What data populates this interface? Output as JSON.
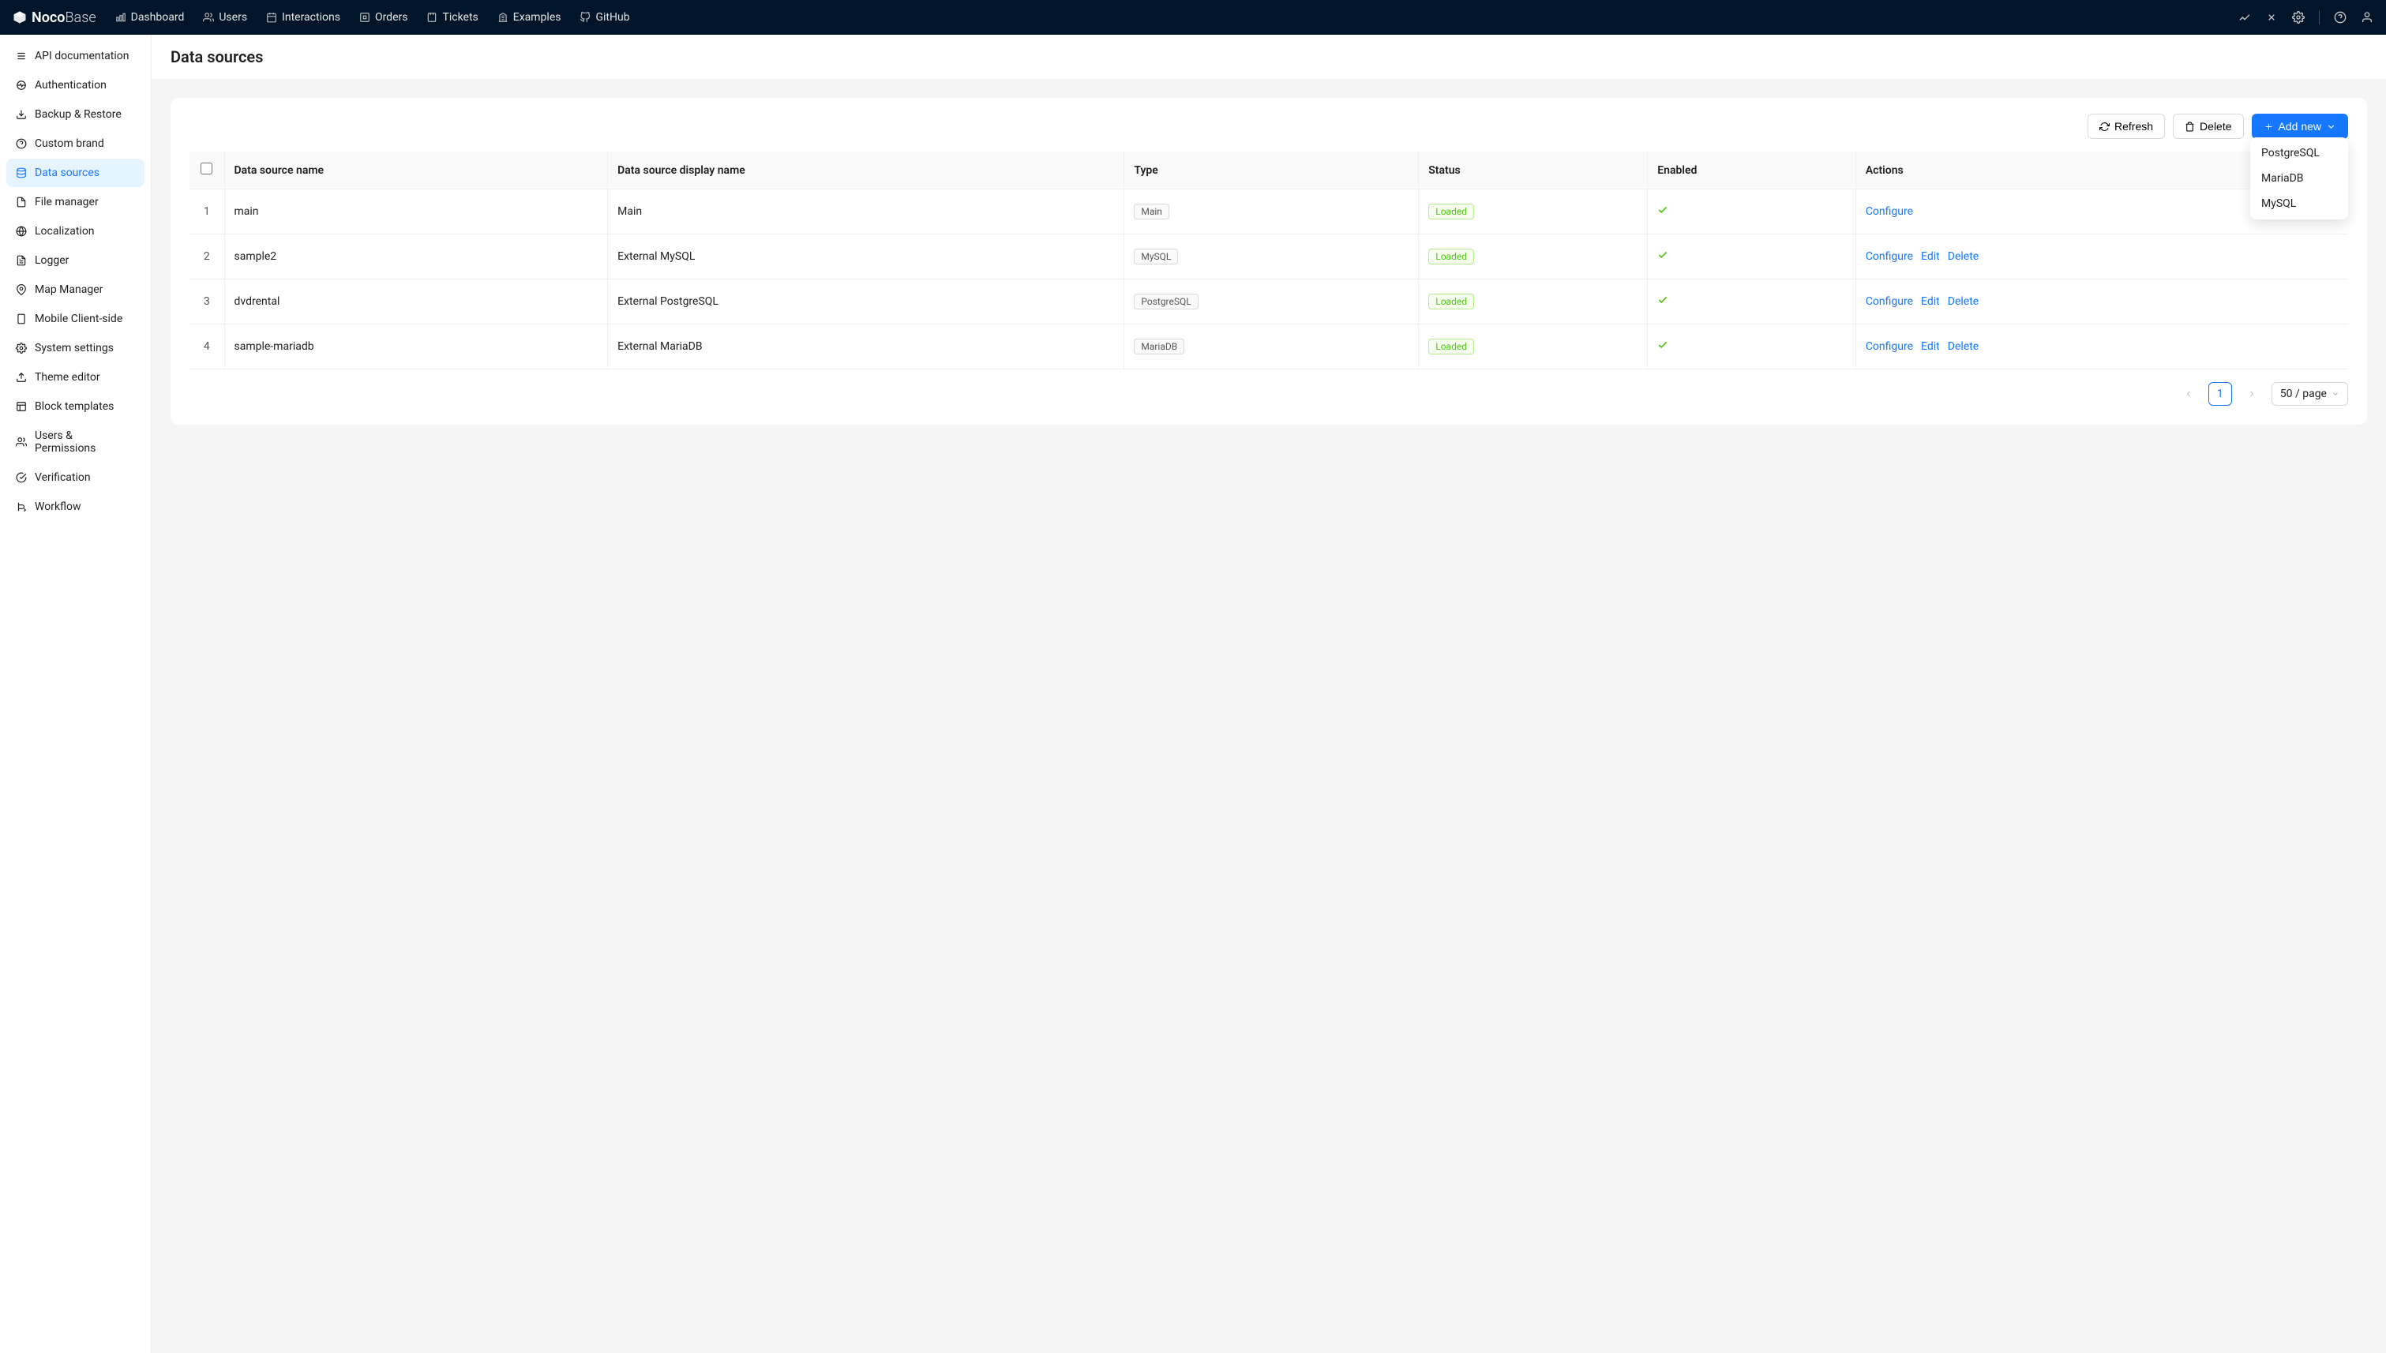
{
  "brand": {
    "name": "Noco",
    "suffix": "Base"
  },
  "topnav": [
    {
      "label": "Dashboard"
    },
    {
      "label": "Users"
    },
    {
      "label": "Interactions"
    },
    {
      "label": "Orders"
    },
    {
      "label": "Tickets"
    },
    {
      "label": "Examples"
    },
    {
      "label": "GitHub"
    }
  ],
  "sidebar": [
    {
      "label": "API documentation"
    },
    {
      "label": "Authentication"
    },
    {
      "label": "Backup & Restore"
    },
    {
      "label": "Custom brand"
    },
    {
      "label": "Data sources",
      "active": true
    },
    {
      "label": "File manager"
    },
    {
      "label": "Localization"
    },
    {
      "label": "Logger"
    },
    {
      "label": "Map Manager"
    },
    {
      "label": "Mobile Client-side"
    },
    {
      "label": "System settings"
    },
    {
      "label": "Theme editor"
    },
    {
      "label": "Block templates"
    },
    {
      "label": "Users & Permissions"
    },
    {
      "label": "Verification"
    },
    {
      "label": "Workflow"
    }
  ],
  "page": {
    "title": "Data sources"
  },
  "toolbar": {
    "refresh": "Refresh",
    "delete": "Delete",
    "add": "Add new"
  },
  "dropdown": [
    {
      "label": "PostgreSQL"
    },
    {
      "label": "MariaDB"
    },
    {
      "label": "MySQL"
    }
  ],
  "table": {
    "headers": {
      "name": "Data source name",
      "display": "Data source display name",
      "type": "Type",
      "status": "Status",
      "enabled": "Enabled",
      "actions": "Actions"
    },
    "rows": [
      {
        "idx": "1",
        "name": "main",
        "display": "Main",
        "type": "Main",
        "status": "Loaded",
        "actions": [
          "Configure"
        ]
      },
      {
        "idx": "2",
        "name": "sample2",
        "display": "External MySQL",
        "type": "MySQL",
        "status": "Loaded",
        "actions": [
          "Configure",
          "Edit",
          "Delete"
        ]
      },
      {
        "idx": "3",
        "name": "dvdrental",
        "display": "External PostgreSQL",
        "type": "PostgreSQL",
        "status": "Loaded",
        "actions": [
          "Configure",
          "Edit",
          "Delete"
        ]
      },
      {
        "idx": "4",
        "name": "sample-mariadb",
        "display": "External MariaDB",
        "type": "MariaDB",
        "status": "Loaded",
        "actions": [
          "Configure",
          "Edit",
          "Delete"
        ]
      }
    ]
  },
  "pagination": {
    "current": "1",
    "pageSize": "50 / page"
  }
}
